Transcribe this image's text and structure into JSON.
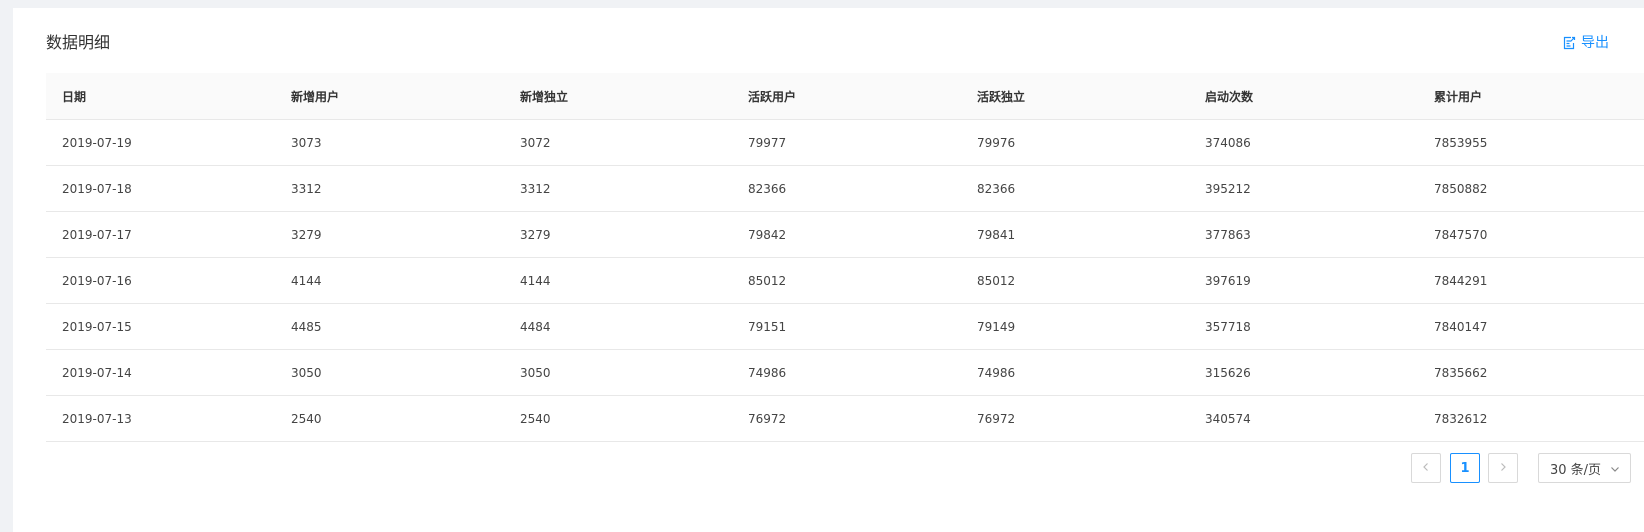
{
  "card": {
    "title": "数据明细",
    "export_label": "导出"
  },
  "table": {
    "headers": [
      "日期",
      "新增用户",
      "新增独立",
      "活跃用户",
      "活跃独立",
      "启动次数",
      "累计用户"
    ],
    "rows": [
      [
        "2019-07-19",
        "3073",
        "3072",
        "79977",
        "79976",
        "374086",
        "7853955"
      ],
      [
        "2019-07-18",
        "3312",
        "3312",
        "82366",
        "82366",
        "395212",
        "7850882"
      ],
      [
        "2019-07-17",
        "3279",
        "3279",
        "79842",
        "79841",
        "377863",
        "7847570"
      ],
      [
        "2019-07-16",
        "4144",
        "4144",
        "85012",
        "85012",
        "397619",
        "7844291"
      ],
      [
        "2019-07-15",
        "4485",
        "4484",
        "79151",
        "79149",
        "357718",
        "7840147"
      ],
      [
        "2019-07-14",
        "3050",
        "3050",
        "74986",
        "74986",
        "315626",
        "7835662"
      ],
      [
        "2019-07-13",
        "2540",
        "2540",
        "76972",
        "76972",
        "340574",
        "7832612"
      ]
    ]
  },
  "pagination": {
    "current_page": "1",
    "page_size_label": "30 条/页"
  },
  "colors": {
    "accent": "#1890ff",
    "border": "#e8e8e8",
    "header_bg": "#fafafa"
  },
  "icons": {
    "export": "export-icon",
    "prev": "chevron-left-icon",
    "next": "chevron-right-icon",
    "select": "chevron-down-icon"
  }
}
